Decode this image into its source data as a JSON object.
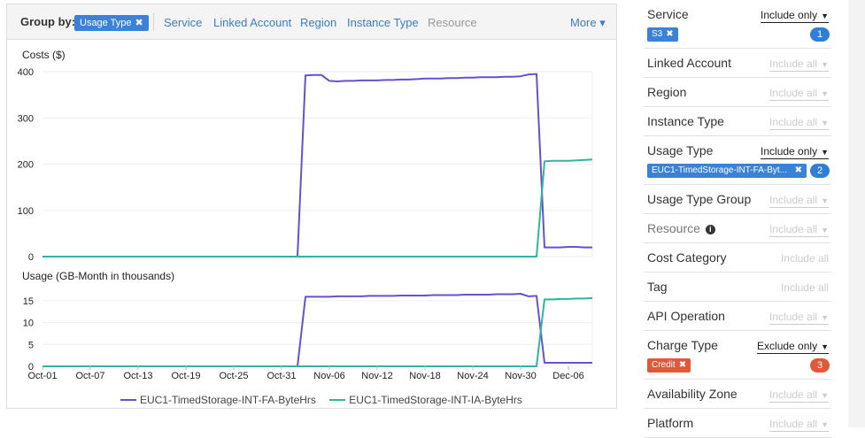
{
  "group_by": {
    "label": "Group by:",
    "selected_chip": "Usage Type",
    "chip_remove": "✖",
    "options": [
      "Service",
      "Linked Account",
      "Region",
      "Instance Type"
    ],
    "disabled_option": "Resource",
    "more_label": "More ▾"
  },
  "chart_data": [
    {
      "type": "line",
      "ylabel": "Costs ($)",
      "ylim": [
        0,
        400
      ],
      "yticks": [
        0,
        100,
        200,
        300,
        400
      ],
      "x": [
        "Oct-01",
        "Oct-02",
        "Oct-03",
        "Oct-04",
        "Oct-05",
        "Oct-06",
        "Oct-07",
        "Oct-08",
        "Oct-09",
        "Oct-10",
        "Oct-11",
        "Oct-12",
        "Oct-13",
        "Oct-14",
        "Oct-15",
        "Oct-16",
        "Oct-17",
        "Oct-18",
        "Oct-19",
        "Oct-20",
        "Oct-21",
        "Oct-22",
        "Oct-23",
        "Oct-24",
        "Oct-25",
        "Oct-26",
        "Oct-27",
        "Oct-28",
        "Oct-29",
        "Oct-30",
        "Oct-31",
        "Nov-01",
        "Nov-02",
        "Nov-03",
        "Nov-04",
        "Nov-05",
        "Nov-06",
        "Nov-07",
        "Nov-08",
        "Nov-09",
        "Nov-10",
        "Nov-11",
        "Nov-12",
        "Nov-13",
        "Nov-14",
        "Nov-15",
        "Nov-16",
        "Nov-17",
        "Nov-18",
        "Nov-19",
        "Nov-20",
        "Nov-21",
        "Nov-22",
        "Nov-23",
        "Nov-24",
        "Nov-25",
        "Nov-26",
        "Nov-27",
        "Nov-28",
        "Nov-29",
        "Nov-30",
        "Dec-01",
        "Dec-02",
        "Dec-03",
        "Dec-04",
        "Dec-05",
        "Dec-06",
        "Dec-07",
        "Dec-08",
        "Dec-09"
      ],
      "series": [
        {
          "name": "EUC1-TimedStorage-INT-FA-ByteHrs",
          "color": "#6a4fcf",
          "values": [
            0,
            0,
            0,
            0,
            0,
            0,
            0,
            0,
            0,
            0,
            0,
            0,
            0,
            0,
            0,
            0,
            0,
            0,
            0,
            0,
            0,
            0,
            0,
            0,
            0,
            0,
            0,
            0,
            0,
            0,
            0,
            0,
            0,
            392,
            393,
            393,
            380,
            379,
            380,
            380,
            381,
            381,
            381,
            382,
            382,
            383,
            383,
            384,
            385,
            385,
            385,
            386,
            386,
            387,
            387,
            388,
            388,
            388,
            389,
            389,
            390,
            394,
            395,
            20,
            20,
            20,
            21,
            21,
            20,
            20
          ]
        },
        {
          "name": "EUC1-TimedStorage-INT-IA-ByteHrs",
          "color": "#2fb5a0",
          "values": [
            0,
            0,
            0,
            0,
            0,
            0,
            0,
            0,
            0,
            0,
            0,
            0,
            0,
            0,
            0,
            0,
            0,
            0,
            0,
            0,
            0,
            0,
            0,
            0,
            0,
            0,
            0,
            0,
            0,
            0,
            0,
            0,
            0,
            0,
            0,
            0,
            0,
            0,
            0,
            0,
            0,
            0,
            0,
            0,
            0,
            0,
            0,
            0,
            0,
            0,
            0,
            0,
            0,
            0,
            0,
            0,
            0,
            0,
            0,
            0,
            0,
            0,
            0,
            206,
            207,
            207,
            207,
            208,
            209,
            210
          ]
        }
      ]
    },
    {
      "type": "line",
      "ylabel": "Usage (GB-Month in thousands)",
      "ylim": [
        0,
        17
      ],
      "yticks": [
        0,
        5,
        10,
        15
      ],
      "xtick_labels": [
        "Oct-01",
        "Oct-07",
        "Oct-13",
        "Oct-19",
        "Oct-25",
        "Oct-31",
        "Nov-06",
        "Nov-12",
        "Nov-18",
        "Nov-24",
        "Nov-30",
        "Dec-06"
      ],
      "series": [
        {
          "name": "EUC1-TimedStorage-INT-FA-ByteHrs",
          "color": "#6a4fcf",
          "values": [
            0,
            0,
            0,
            0,
            0,
            0,
            0,
            0,
            0,
            0,
            0,
            0,
            0,
            0,
            0,
            0,
            0,
            0,
            0,
            0,
            0,
            0,
            0,
            0,
            0,
            0,
            0,
            0,
            0,
            0,
            0,
            0,
            0,
            15.9,
            15.9,
            15.9,
            15.9,
            16.0,
            16.0,
            16.0,
            16.0,
            16.1,
            16.1,
            16.1,
            16.1,
            16.2,
            16.2,
            16.2,
            16.2,
            16.3,
            16.3,
            16.3,
            16.3,
            16.4,
            16.4,
            16.4,
            16.4,
            16.5,
            16.5,
            16.5,
            16.6,
            16.0,
            16.1,
            0.8,
            0.8,
            0.8,
            0.8,
            0.8,
            0.8,
            0.8
          ]
        },
        {
          "name": "EUC1-TimedStorage-INT-IA-ByteHrs",
          "color": "#2fb5a0",
          "values": [
            0,
            0,
            0,
            0,
            0,
            0,
            0,
            0,
            0,
            0,
            0,
            0,
            0,
            0,
            0,
            0,
            0,
            0,
            0,
            0,
            0,
            0,
            0,
            0,
            0,
            0,
            0,
            0,
            0,
            0,
            0,
            0,
            0,
            0,
            0,
            0,
            0,
            0,
            0,
            0,
            0,
            0,
            0,
            0,
            0,
            0,
            0,
            0,
            0,
            0,
            0,
            0,
            0,
            0,
            0,
            0,
            0,
            0,
            0,
            0,
            0,
            0,
            0,
            15.3,
            15.3,
            15.4,
            15.4,
            15.5,
            15.5,
            15.6
          ]
        }
      ]
    }
  ],
  "legend": [
    "EUC1-TimedStorage-INT-FA-ByteHrs",
    "EUC1-TimedStorage-INT-IA-ByteHrs"
  ],
  "filters": [
    {
      "label": "Service",
      "mode": "Include only",
      "active": true,
      "chip": "S3",
      "chip_color": "blue",
      "count": "1"
    },
    {
      "label": "Linked Account",
      "mode": "Include all",
      "active": false
    },
    {
      "label": "Region",
      "mode": "Include all",
      "active": false
    },
    {
      "label": "Instance Type",
      "mode": "Include all",
      "active": false
    },
    {
      "label": "Usage Type",
      "mode": "Include only",
      "active": true,
      "chip": "EUC1-TimedStorage-INT-FA-Byt...",
      "chip_color": "blue",
      "count": "2"
    },
    {
      "label": "Usage Type Group",
      "mode": "Include all",
      "active": false
    },
    {
      "label": "Resource",
      "mode": "Include all",
      "active": false,
      "muted": true,
      "info": true
    },
    {
      "label": "Cost Category",
      "mode": "Include all",
      "active": false,
      "noline": true
    },
    {
      "label": "Tag",
      "mode": "Include all",
      "active": false,
      "noline": true
    },
    {
      "label": "API Operation",
      "mode": "Include all",
      "active": false
    },
    {
      "label": "Charge Type",
      "mode": "Exclude only",
      "active": true,
      "chip": "Credit",
      "chip_color": "red",
      "count": "3"
    },
    {
      "label": "Availability Zone",
      "mode": "Include all",
      "active": false
    },
    {
      "label": "Platform",
      "mode": "Include all",
      "active": false
    }
  ],
  "colors": {
    "accent": "#3b82d6",
    "link": "#3b7dc4",
    "danger": "#e05a3a",
    "purple_series": "#6a4fcf",
    "teal_series": "#2fb5a0"
  }
}
